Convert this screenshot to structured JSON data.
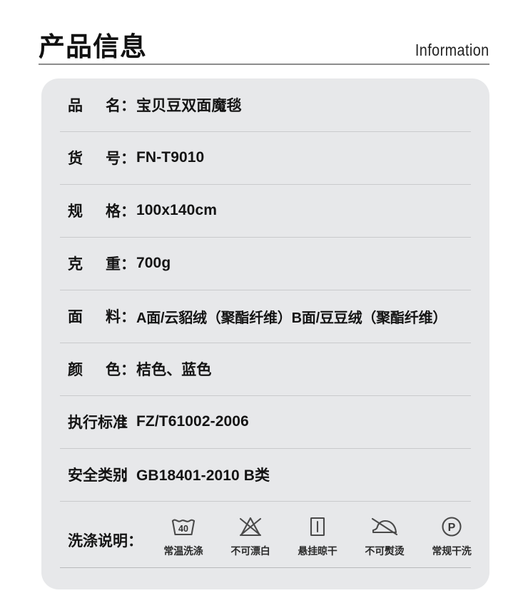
{
  "header": {
    "title": "产品信息",
    "subtitle": "Information"
  },
  "spec_rows": [
    {
      "label_a": "品",
      "label_b": "名",
      "colon": "：",
      "value": "宝贝豆双面魔毯"
    },
    {
      "label_a": "货",
      "label_b": "号",
      "colon": "：",
      "value": "FN-T9010"
    },
    {
      "label_a": "规",
      "label_b": "格",
      "colon": "：",
      "value": "100x140cm"
    },
    {
      "label_a": "克",
      "label_b": "重",
      "colon": "：",
      "value": "700g"
    },
    {
      "label_a": "面",
      "label_b": "料",
      "colon": "：",
      "value": "A面/云貂绒（聚酯纤维）B面/豆豆绒（聚酯纤维）"
    },
    {
      "label_a": "颜",
      "label_b": "色",
      "colon": "：",
      "value": "桔色、蓝色"
    }
  ],
  "spec_rows_wide": [
    {
      "label": "执行标准",
      "colon": "：",
      "value": "FZ/T61002-2006"
    },
    {
      "label": "安全类别",
      "colon": "：",
      "value": "GB18401-2010 B类"
    }
  ],
  "care": {
    "label": "洗涤说明：",
    "items": [
      {
        "icon": "wash-tub-40-icon",
        "temperature": "40",
        "text": "常温洗涤"
      },
      {
        "icon": "do-not-bleach-icon",
        "text": "不可漂白"
      },
      {
        "icon": "line-dry-icon",
        "text": "悬挂晾干"
      },
      {
        "icon": "do-not-iron-icon",
        "text": "不可熨烫"
      },
      {
        "icon": "dry-clean-p-icon",
        "text": "常规干洗"
      }
    ]
  },
  "colors": {
    "page_background": "#ffffff",
    "card_background": "#e7e8ea",
    "divider": "#c9cacc",
    "header_rule": "#8d8d8d",
    "text": "#141414"
  }
}
